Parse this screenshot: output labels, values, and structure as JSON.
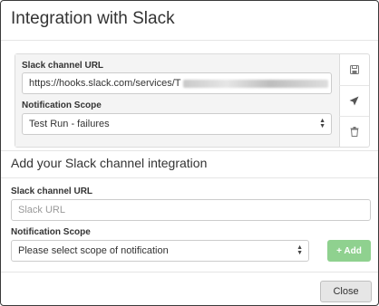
{
  "modal": {
    "title": "Integration with Slack"
  },
  "existing": {
    "url_label": "Slack channel URL",
    "url_value": "https://hooks.slack.com/services/T",
    "scope_label": "Notification Scope",
    "scope_value": "Test Run - failures",
    "actions": [
      {
        "name": "save-icon"
      },
      {
        "name": "send-icon"
      },
      {
        "name": "trash-icon"
      }
    ]
  },
  "add_section": {
    "title": "Add your Slack channel integration",
    "url_label": "Slack channel URL",
    "url_placeholder": "Slack URL",
    "scope_label": "Notification Scope",
    "scope_placeholder": "Please select scope of notification",
    "add_button": "+ Add"
  },
  "footer": {
    "close_button": "Close"
  },
  "colors": {
    "add_button_bg": "#8fd18f",
    "card_bg": "#f4f4f4"
  }
}
